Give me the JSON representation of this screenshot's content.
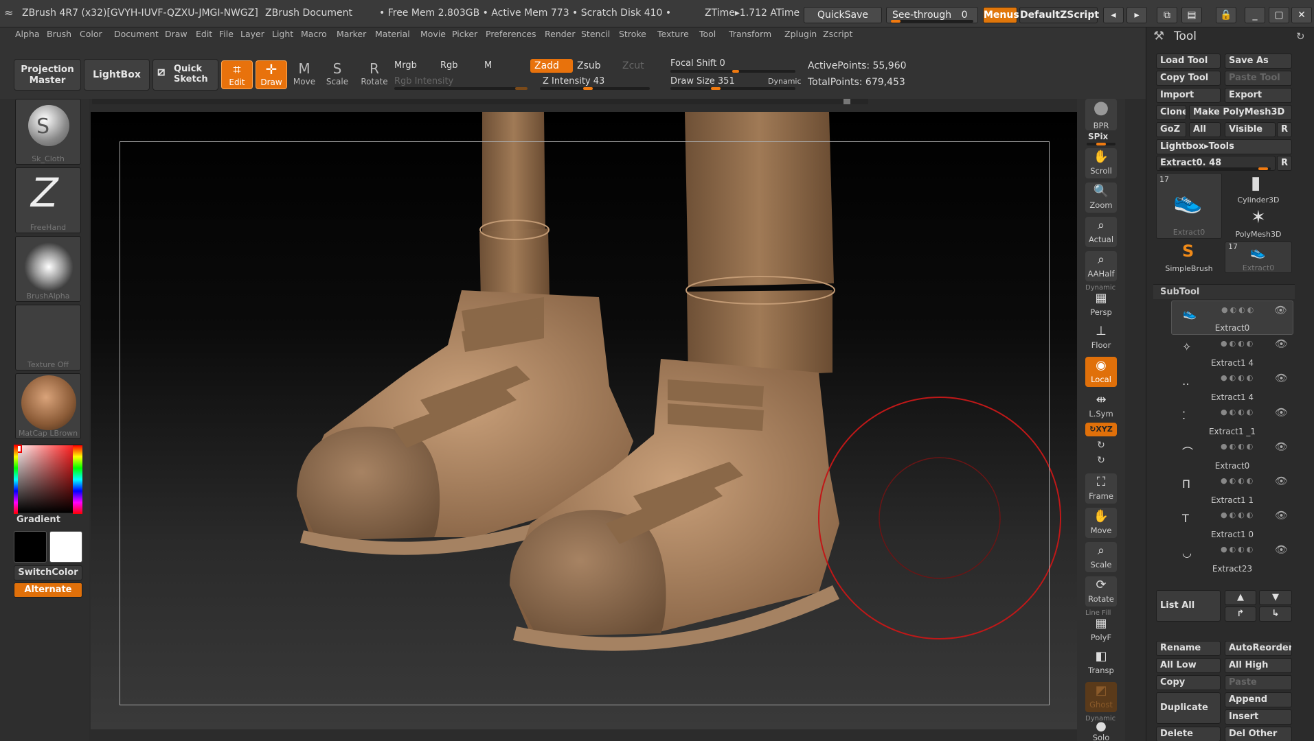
{
  "title_bar": {
    "app_title": "ZBrush 4R7 (x32)[GVYH-IUVF-QZXU-JMGI-NWGZ]",
    "document": "ZBrush Document",
    "status": "• Free Mem 2.803GB • Active Mem 773 • Scratch Disk 410 •",
    "ztime": "ZTime▸1.712 ATime",
    "quicksave": "QuickSave",
    "see_through_label": "See-through",
    "see_through_value": "0",
    "see_through_level": 0,
    "menus": "Menus",
    "default_script": "DefaultZScript"
  },
  "menu": [
    "Alpha",
    "Brush",
    "Color",
    "Document",
    "Draw",
    "Edit",
    "File",
    "Layer",
    "Light",
    "Macro",
    "Marker",
    "Material",
    "Movie",
    "Picker",
    "Preferences",
    "Render",
    "Stencil",
    "Stroke",
    "Texture",
    "Tool",
    "Transform",
    "Zplugin",
    "Zscript"
  ],
  "toolbar": {
    "projection_master": "Projection Master",
    "lightbox": "LightBox",
    "quick_sketch": "Quick Sketch",
    "edit": "Edit",
    "draw": "Draw",
    "move": "Move",
    "scale": "Scale",
    "rotate": "Rotate",
    "mrgb": "Mrgb",
    "rgb": "Rgb",
    "m": "M",
    "rgb_intensity": "Rgb Intensity",
    "zadd": "Zadd",
    "zsub": "Zsub",
    "zcut": "Zcut",
    "z_intensity": "Z Intensity 43",
    "z_intensity_value": 43,
    "focal_shift": "Focal Shift 0",
    "draw_size": "Draw Size 351",
    "draw_size_value": 351,
    "dynamic": "Dynamic",
    "active_points": "ActivePoints: 55,960",
    "total_points": "TotalPoints: 679,453"
  },
  "left_shelf": {
    "brush": "Sk_Cloth",
    "stroke": "FreeHand",
    "alpha": "BrushAlpha",
    "texture": "Texture Off",
    "material": "MatCap LBrown",
    "gradient": "Gradient",
    "switch_color": "SwitchColor",
    "alternate": "Alternate"
  },
  "right_shelf": {
    "bpr": "BPR",
    "spix": "SPix",
    "scroll": "Scroll",
    "zoom": "Zoom",
    "actual": "Actual",
    "aahalf": "AAHalf",
    "dynamic": "Dynamic",
    "persp": "Persp",
    "floor": "Floor",
    "local": "Local",
    "lsym": "L.Sym",
    "xyz": "↻XYZ",
    "frame": "Frame",
    "move": "Move",
    "scale": "Scale",
    "rotate": "Rotate",
    "line_fill": "Line Fill",
    "polyf": "PolyF",
    "transp": "Transp",
    "ghost": "Ghost",
    "solo": "Solo"
  },
  "tool_panel": {
    "title": "Tool",
    "load_tool": "Load Tool",
    "save_as": "Save As",
    "copy_tool": "Copy Tool",
    "paste_tool": "Paste Tool",
    "import": "Import",
    "export": "Export",
    "clone": "Clone",
    "make_polymesh": "Make PolyMesh3D",
    "goz": "GoZ",
    "all": "All",
    "visible": "Visible",
    "r": "R",
    "lightbox_tools": "Lightbox▸Tools",
    "current_tool": "Extract0. 48",
    "thumb_count": "17",
    "thumbs": [
      "Extract0",
      "Cylinder3D",
      "PolyMesh3D",
      "SimpleBrush",
      "Extract0"
    ],
    "subtool_header": "SubTool",
    "subtools": [
      "Extract0",
      "Extract1 4",
      "Extract1 4",
      "Extract1 _1",
      "Extract0",
      "Extract1 1",
      "Extract1 0",
      "Extract23"
    ],
    "list_all": "List All",
    "rename": "Rename",
    "autoreorder": "AutoReorder",
    "all_low": "All Low",
    "all_high": "All High",
    "copy": "Copy",
    "paste": "Paste",
    "duplicate": "Duplicate",
    "append": "Append",
    "insert": "Insert",
    "delete": "Delete",
    "del_other": "Del Other"
  },
  "colors": {
    "accent": "#e8720c",
    "panel": "#2b2b2b",
    "brush_cursor": "#c01818"
  }
}
